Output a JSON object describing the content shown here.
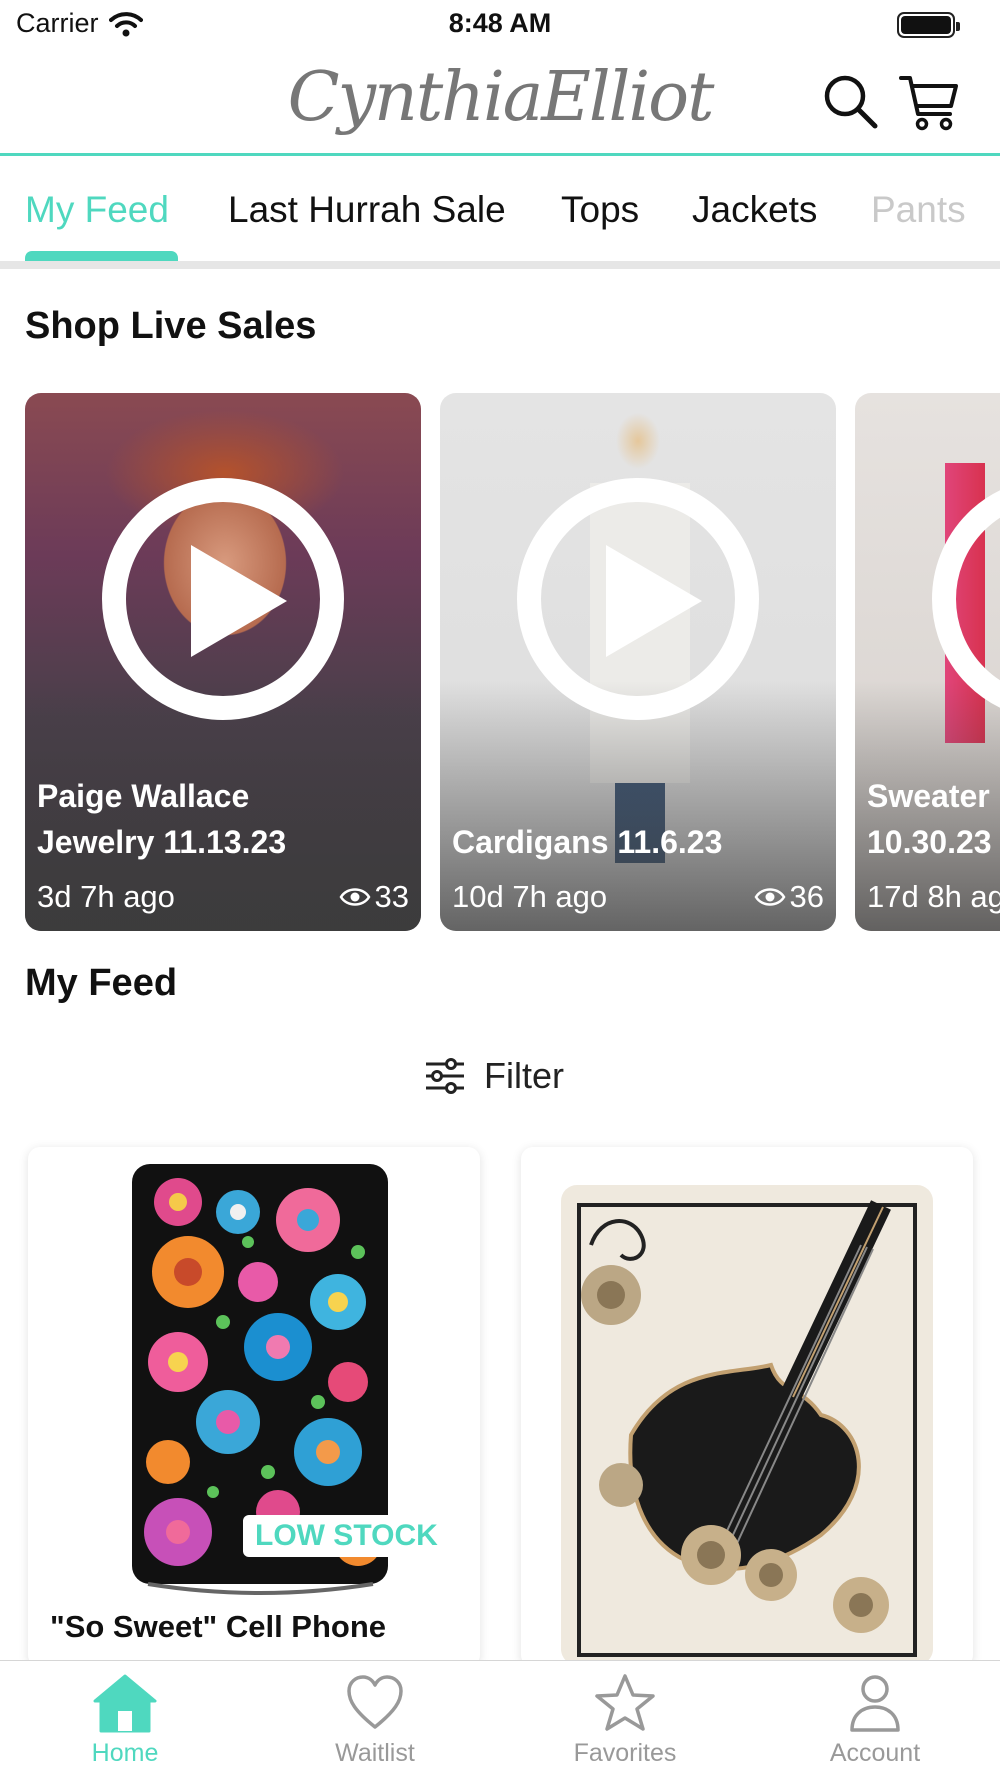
{
  "status_bar": {
    "carrier": "Carrier",
    "time": "8:48 AM"
  },
  "header": {
    "logo_text": "CynthiaElliot"
  },
  "tabs": [
    {
      "label": "My Feed"
    },
    {
      "label": "Last Hurrah Sale"
    },
    {
      "label": "Tops"
    },
    {
      "label": "Jackets"
    },
    {
      "label": "Pants"
    }
  ],
  "live_section": {
    "title": "Shop Live Sales",
    "cards": [
      {
        "title_line1": "Paige Wallace",
        "title_line2": "Jewelry 11.13.23",
        "ago": "3d 7h ago",
        "views": "33"
      },
      {
        "title_line1": "",
        "title_line2": "Cardigans 11.6.23",
        "ago": "10d 7h ago",
        "views": "36"
      },
      {
        "title_line1": "Sweater",
        "title_line2": "10.30.23",
        "ago": "17d 8h ago",
        "views": ""
      }
    ]
  },
  "feed_section": {
    "title": "My Feed",
    "filter_label": "Filter",
    "products": [
      {
        "name": "\"So Sweet\" Cell Phone",
        "badge": "LOW STOCK"
      },
      {
        "name": "",
        "badge": ""
      }
    ]
  },
  "bottom_nav": [
    {
      "label": "Home",
      "icon": "home-icon"
    },
    {
      "label": "Waitlist",
      "icon": "heart-icon"
    },
    {
      "label": "Favorites",
      "icon": "star-icon"
    },
    {
      "label": "Account",
      "icon": "person-icon"
    }
  ],
  "colors": {
    "accent": "#4fd8bf",
    "inactive": "#999999"
  }
}
